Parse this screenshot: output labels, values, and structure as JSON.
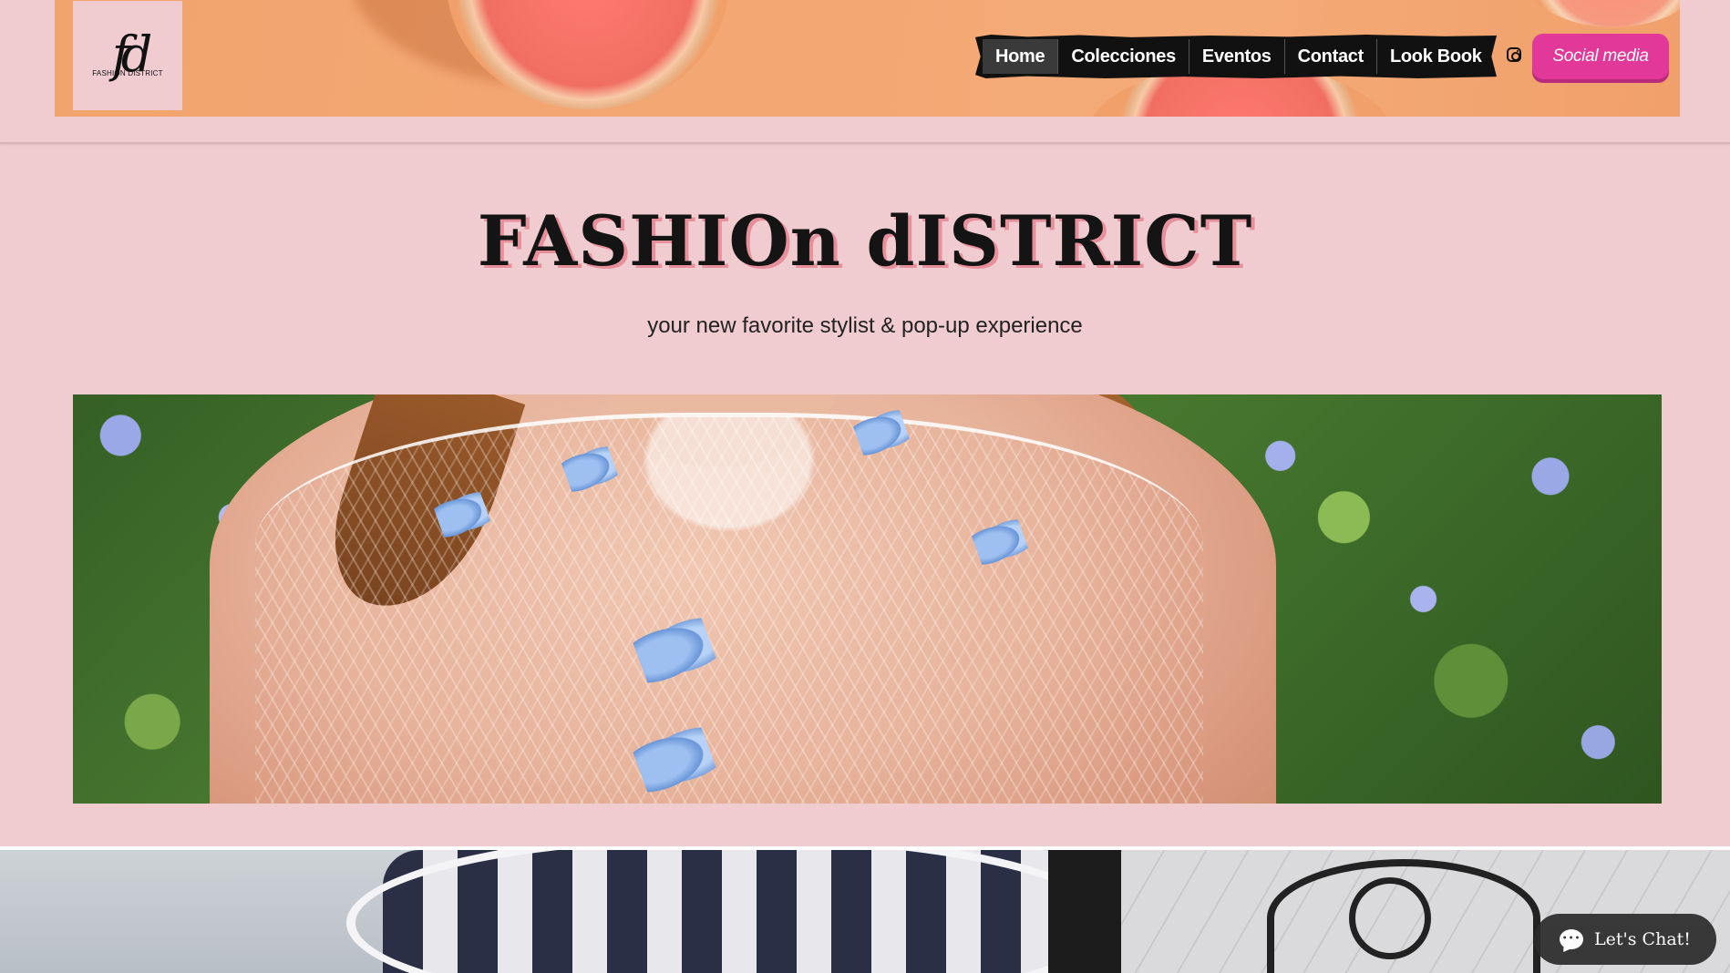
{
  "logo": {
    "mark": "fd",
    "text": "FASHION DISTRICT"
  },
  "nav": {
    "items": [
      {
        "label": "Home",
        "active": true
      },
      {
        "label": "Colecciones"
      },
      {
        "label": "Eventos"
      },
      {
        "label": "Contact"
      },
      {
        "label": "Look Book"
      }
    ]
  },
  "header": {
    "instagram_icon": "instagram-icon",
    "social_button": "Social media"
  },
  "hero": {
    "title": "FASHIOn dISTRICT",
    "tagline": "your new favorite stylist & pop-up experience"
  },
  "chat": {
    "label": "Let's Chat!",
    "icon": "chat-bubble-icon"
  },
  "colors": {
    "background": "#f0cbcf",
    "accent": "#e2389a",
    "nav_bg": "#111111",
    "title_shadow": "#e78f9a"
  }
}
